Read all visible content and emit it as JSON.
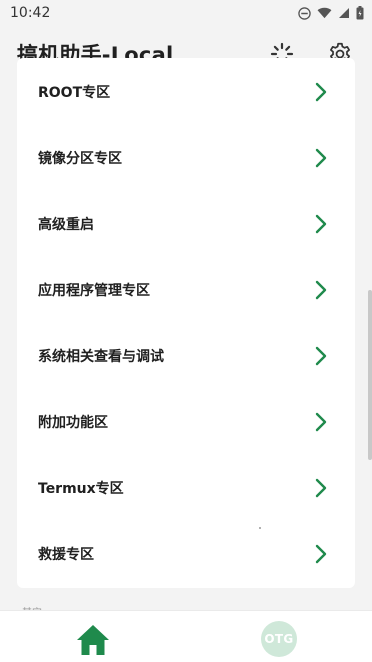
{
  "status_bar": {
    "time": "10:42"
  },
  "app_bar": {
    "title": "搞机助手-Local"
  },
  "menu": {
    "items": [
      {
        "label": "ROOT专区"
      },
      {
        "label": "镜像分区专区"
      },
      {
        "label": "高级重启"
      },
      {
        "label": "应用程序管理专区"
      },
      {
        "label": "系统相关查看与调试"
      },
      {
        "label": "附加功能区"
      },
      {
        "label": "Termux专区"
      },
      {
        "label": "救援专区"
      }
    ]
  },
  "section_hint": "其它",
  "bottom_nav": {
    "home_icon": "home-icon",
    "otg_label": "OTG"
  },
  "colors": {
    "accent": "#1f8a4c",
    "otg_bg": "#cfe8d9",
    "background": "#f3f3f3"
  }
}
